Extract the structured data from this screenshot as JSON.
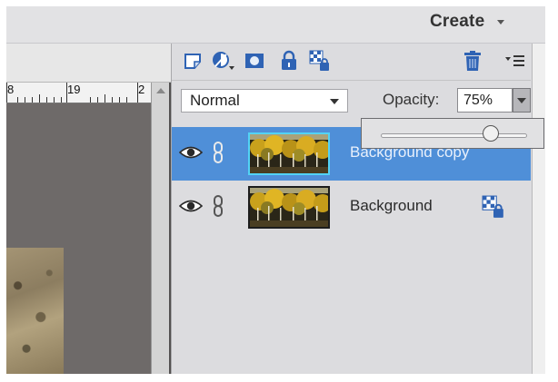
{
  "header": {
    "create_label": "Create"
  },
  "document": {
    "ruler": {
      "numbers": [
        "8",
        "19",
        "2"
      ]
    }
  },
  "layers_panel": {
    "toolbar_icons": [
      "new-layer-icon",
      "adjustment-layer-icon",
      "layer-mask-icon",
      "lock-all-icon",
      "lock-transparency-icon",
      "delete-layer-icon",
      "panel-menu-icon"
    ],
    "blend_mode": "Normal",
    "opacity_label": "Opacity:",
    "opacity_value": "75%",
    "opacity_slider_fraction": 0.75,
    "layers": [
      {
        "name": "Background copy",
        "selected": true,
        "visible": true
      },
      {
        "name": "Background",
        "selected": false,
        "visible": true,
        "locked": true
      }
    ]
  },
  "colors": {
    "selection_blue": "#4f8fd8",
    "thumb_highlight": "#52d3f5",
    "icon_blue": "#2f63b4",
    "canvas_gray": "#6e6a69"
  }
}
